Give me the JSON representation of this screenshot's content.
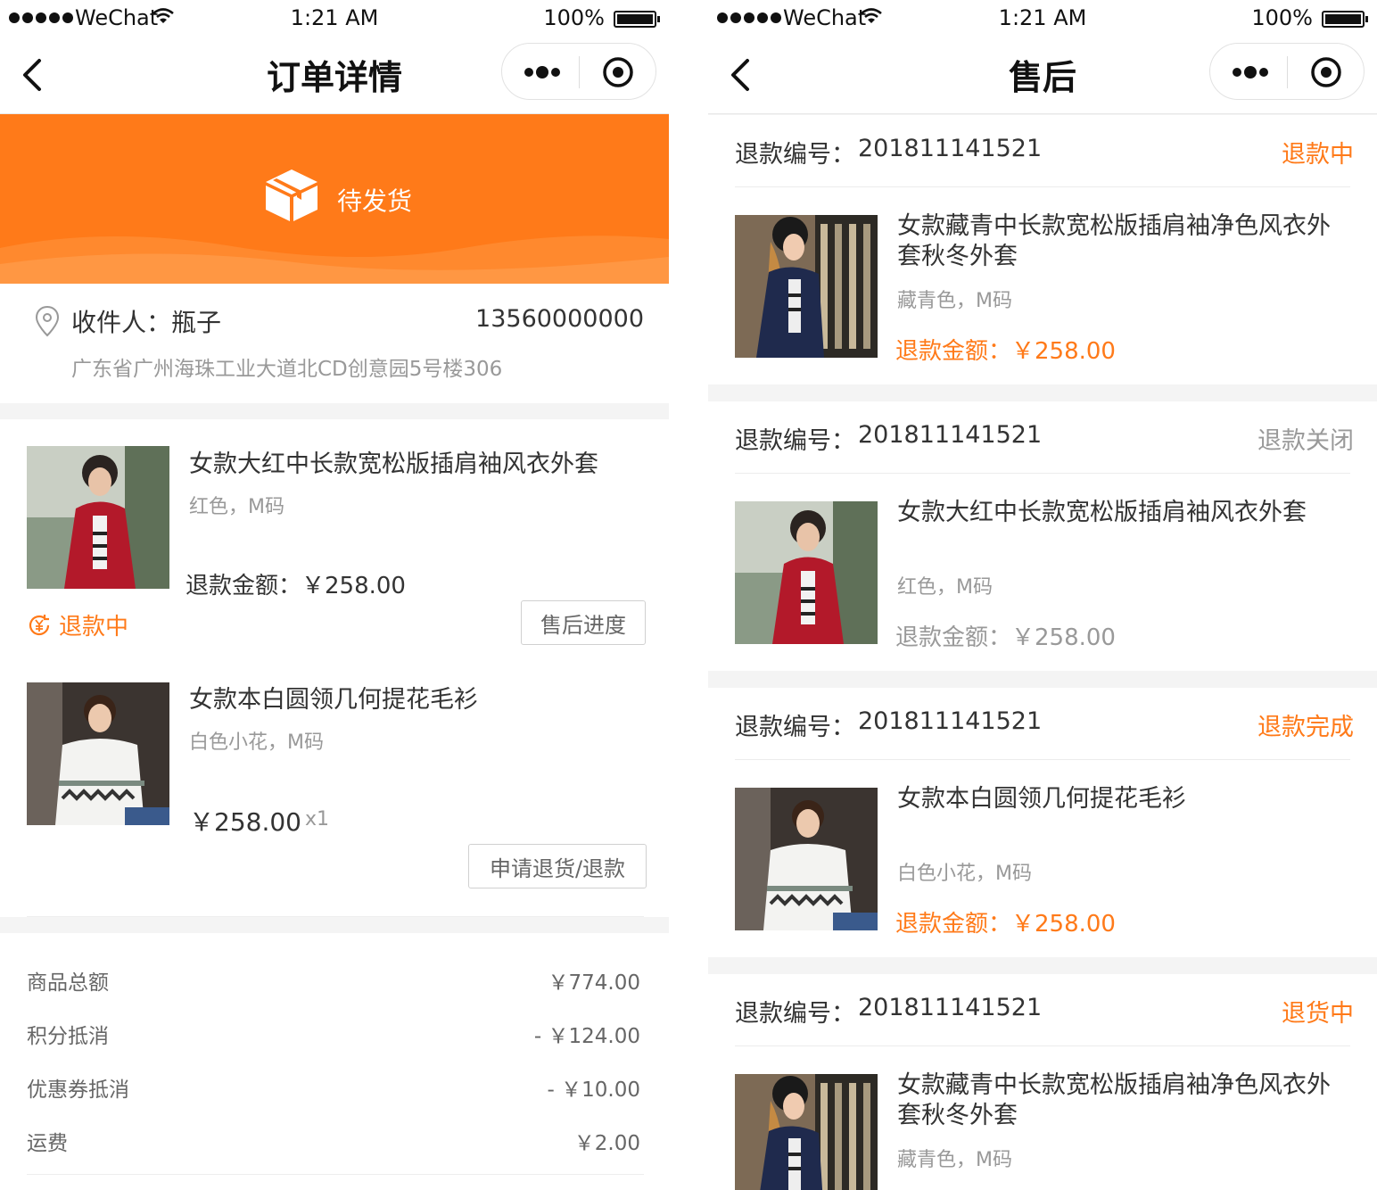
{
  "status_bar": {
    "carrier": "WeChat",
    "time": "1:21 AM",
    "battery": "100%"
  },
  "left": {
    "nav_title": "订单详情",
    "order_status": "待发货",
    "address": {
      "label": "收件人：",
      "name": "瓶子",
      "phone": "13560000000",
      "detail": "广东省广州海珠工业大道北CD创意园5号楼306"
    },
    "goods": [
      {
        "title": "女款大红中长款宽松版插肩袖风衣外套",
        "spec": "红色，M码",
        "refund_text": "退款金额：￥258.00",
        "refund_state": "退款中",
        "button": "售后进度"
      },
      {
        "title": "女款本白圆领几何提花毛衫",
        "spec": "白色小花，M码",
        "price": "￥258.00",
        "qty": "x1",
        "button": "申请退货/退款"
      }
    ],
    "summary": [
      {
        "label": "商品总额",
        "value": "￥774.00"
      },
      {
        "label": "积分抵消",
        "value": "- ￥124.00"
      },
      {
        "label": "优惠券抵消",
        "value": "- ￥10.00"
      },
      {
        "label": "运费",
        "value": "￥2.00"
      }
    ]
  },
  "right": {
    "nav_title": "售后",
    "refund_no_label": "退款编号：",
    "cards": [
      {
        "refund_no": "201811141521",
        "status": "退款中",
        "status_color": "#ff7a19",
        "title": "女款藏青中长款宽松版插肩袖净色风衣外套秋冬外套",
        "spec": "藏青色，M码",
        "refund_text": "退款金额：￥258.00",
        "refund_color": "#ff7a19"
      },
      {
        "refund_no": "201811141521",
        "status": "退款关闭",
        "status_color": "#999999",
        "title": "女款大红中长款宽松版插肩袖风衣外套",
        "spec": "红色，M码",
        "refund_text": "退款金额：￥258.00",
        "refund_color": "#999999"
      },
      {
        "refund_no": "201811141521",
        "status": "退款完成",
        "status_color": "#ff7a19",
        "title": "女款本白圆领几何提花毛衫",
        "spec": "白色小花，M码",
        "refund_text": "退款金额：￥258.00",
        "refund_color": "#ff7a19"
      },
      {
        "refund_no": "201811141521",
        "status": "退货中",
        "status_color": "#ff7a19",
        "title": "女款藏青中长款宽松版插肩袖净色风衣外套秋冬外套",
        "spec": "藏青色，M码",
        "refund_text": "",
        "refund_color": "#ff7a19"
      }
    ]
  },
  "colors": {
    "accent": "#ff7a19",
    "muted": "#999999"
  }
}
